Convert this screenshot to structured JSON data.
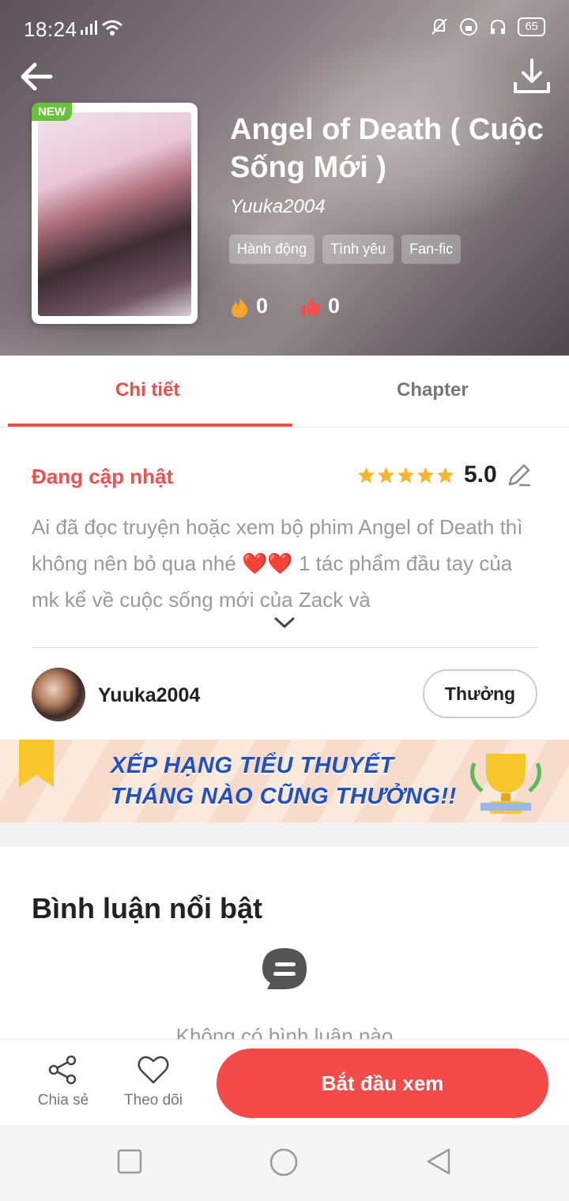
{
  "status_bar": {
    "time": "18:24",
    "battery": "65"
  },
  "header": {
    "cover_badge": "NEW",
    "title": "Angel of Death ( Cuộc Sống Mới )",
    "author": "Yuuka2004",
    "tags": [
      "Hành động",
      "Tình yêu",
      "Fan-fic"
    ],
    "fire_count": "0",
    "like_count": "0"
  },
  "tabs": [
    {
      "label": "Chi tiết"
    },
    {
      "label": "Chapter"
    }
  ],
  "detail": {
    "status": "Đang cập nhật",
    "rating": "5.0",
    "stars": 5,
    "description": "Ai đã đọc truyện hoặc xem bộ phim Angel of Death thì không nên bỏ qua nhé ❤️❤️ 1 tác phẩm đầu tay của mk kể về cuộc sống mới của Zack và"
  },
  "author_row": {
    "name": "Yuuka2004",
    "reward_label": "Thưởng"
  },
  "banner": {
    "line1": "XẾP HẠNG TIỂU THUYẾT",
    "line2": "THÁNG NÀO CŨNG THƯỞNG!!"
  },
  "comments": {
    "title": "Bình luận nổi bật",
    "empty_text": "Không có bình luận nào"
  },
  "bottom_bar": {
    "share_label": "Chia sẻ",
    "follow_label": "Theo dõi",
    "start_label": "Bắt đầu xem"
  },
  "colors": {
    "accent": "#F44A4A",
    "status_red": "#EE5050",
    "star": "#F7B52C",
    "new_badge": "#67C23A"
  }
}
